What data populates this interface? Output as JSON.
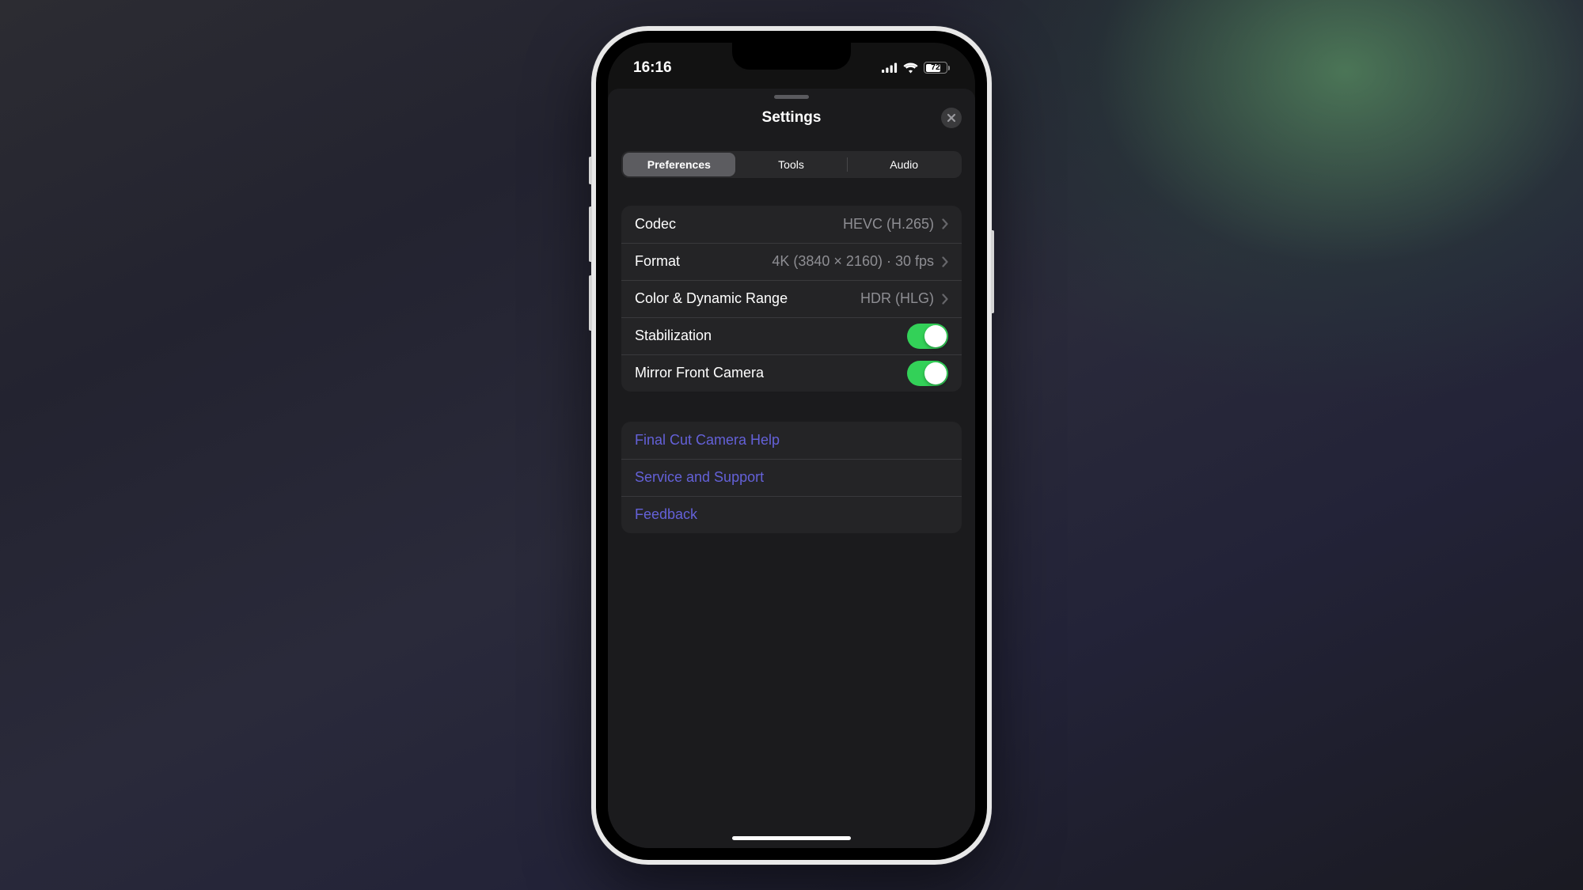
{
  "status_bar": {
    "time": "16:16",
    "battery": "72"
  },
  "sheet": {
    "title": "Settings"
  },
  "tabs": {
    "preferences": "Preferences",
    "tools": "Tools",
    "audio": "Audio"
  },
  "settings": {
    "codec": {
      "label": "Codec",
      "value": "HEVC (H.265)"
    },
    "format": {
      "label": "Format",
      "value": "4K (3840 × 2160) · 30 fps"
    },
    "color": {
      "label": "Color & Dynamic Range",
      "value": "HDR (HLG)"
    },
    "stabilization": {
      "label": "Stabilization",
      "on": true
    },
    "mirror": {
      "label": "Mirror Front Camera",
      "on": true
    }
  },
  "links": {
    "help": "Final Cut Camera Help",
    "support": "Service and Support",
    "feedback": "Feedback"
  }
}
